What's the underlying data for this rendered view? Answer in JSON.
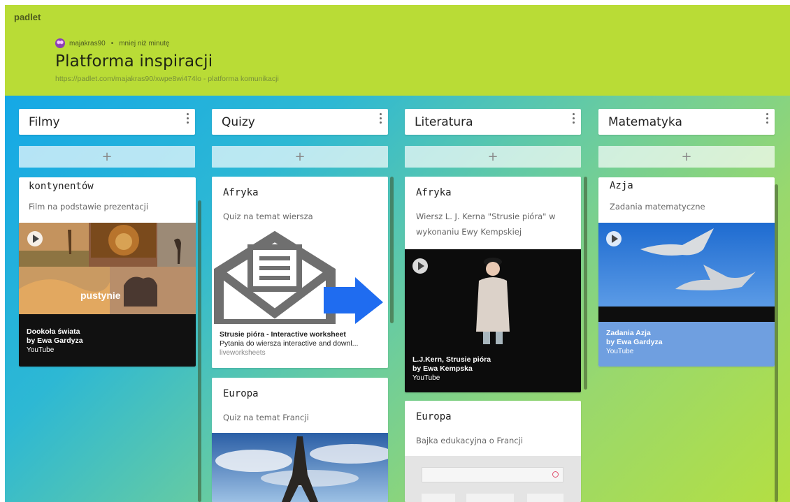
{
  "header": {
    "brand": "padlet",
    "author": "majakras90",
    "time": "mniej niż minutę",
    "title": "Platforma inspiracji",
    "subtitle": "https://padlet.com/majakras90/xwpe8wi474lo - platforma komunikacji"
  },
  "add_label": "+",
  "columns": [
    {
      "title": "Filmy",
      "cards": [
        {
          "title": "kontynentów",
          "desc": "Film na podstawie prezentacji",
          "thumb_text": "pustynie",
          "link_title": "Dookoła świata",
          "link_author": "by Ewa Gardyza",
          "link_source": "YouTube"
        }
      ]
    },
    {
      "title": "Quizy",
      "cards": [
        {
          "title": "Afryka",
          "desc": "Quiz na temat wiersza",
          "link_title": "Strusie pióra - Interactive worksheet",
          "link_desc": "Pytania do wiersza interactive and downl...",
          "link_source": "liveworksheets"
        },
        {
          "title": "Europa",
          "desc": "Quiz na temat Francji"
        }
      ]
    },
    {
      "title": "Literatura",
      "cards": [
        {
          "title": "Afryka",
          "desc": "Wiersz L. J. Kerna \"Strusie pióra\" w wykonaniu Ewy Kempskiej",
          "link_title": "L.J.Kern, Strusie pióra",
          "link_author": "by Ewa Kempska",
          "link_source": "YouTube"
        },
        {
          "title": "Europa",
          "desc": "Bajka edukacyjna o Francji"
        }
      ]
    },
    {
      "title": "Matematyka",
      "cards": [
        {
          "title": "Azja",
          "desc": "Zadania matematyczne",
          "link_title": "Zadania Azja",
          "link_author": "by Ewa Gardyza",
          "link_source": "YouTube"
        }
      ]
    }
  ]
}
